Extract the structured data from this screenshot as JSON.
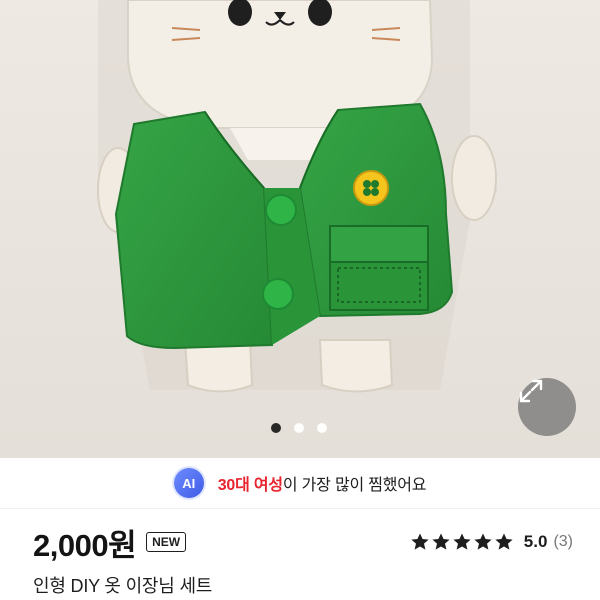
{
  "ai_highlight": {
    "badge": "AI",
    "highlight": "30대 여성",
    "rest": "이 가장 많이 찜했어요"
  },
  "product": {
    "price": "2,000원",
    "new_badge": "NEW",
    "rating_score": "5.0",
    "rating_count": "(3)",
    "stars": 5,
    "title": "인형 DIY 옷 이장님 세트"
  },
  "carousel": {
    "total": 3,
    "active": 1
  },
  "icons": [
    "expand-icon",
    "star-icon",
    "ai-badge",
    "clover-icon"
  ],
  "colors": {
    "vest_green": "#2e9a3e",
    "highlight_red": "#e8242f",
    "ai_blue": "#4a67f0",
    "star": "#1e1e1e"
  }
}
